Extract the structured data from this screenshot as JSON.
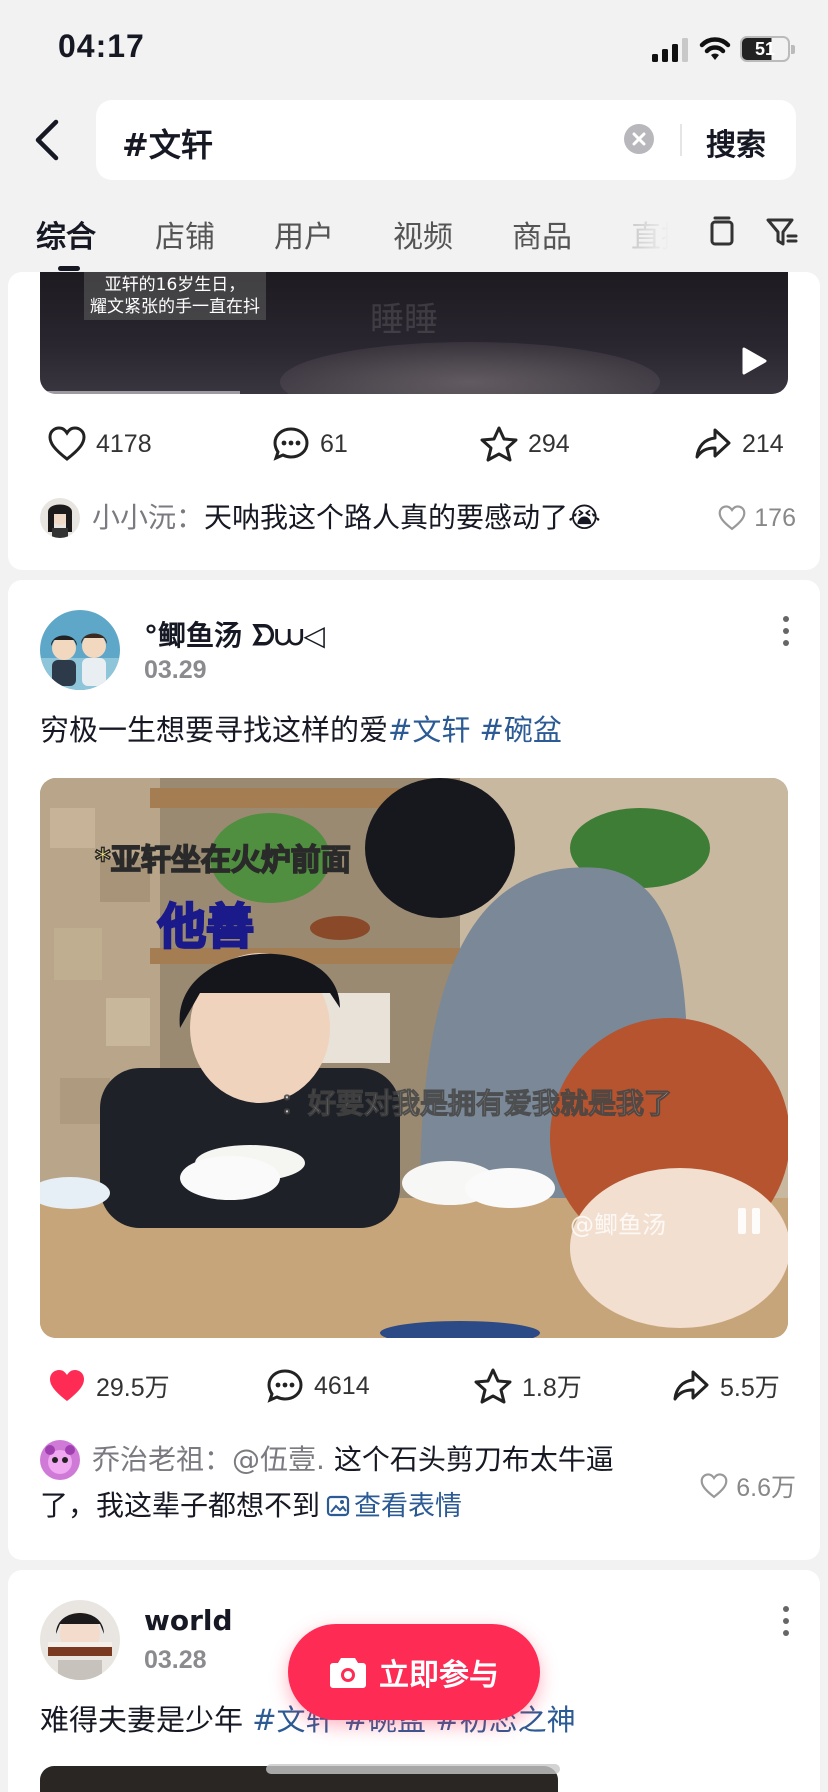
{
  "status": {
    "time": "04:17",
    "battery": "51"
  },
  "search": {
    "query": "#文轩",
    "button": "搜索"
  },
  "tabs": [
    "综合",
    "店铺",
    "用户",
    "视频",
    "商品",
    "直播"
  ],
  "post1": {
    "video_caption_line1": "亚轩的16岁生日，",
    "video_caption_line2": "耀文紧张的手一直在抖",
    "video_watermark": "睡睡",
    "likes": "4178",
    "comments": "61",
    "favorites": "294",
    "shares": "214",
    "comment": {
      "name": "小小沅：",
      "text": "天呐我这个路人真的要感动了😭",
      "likes": "176"
    }
  },
  "post2": {
    "author": "°鲫鱼汤 ᗤ⩊◁",
    "date": "03.29",
    "text": "穷极一生想要寻找这样的爱",
    "tags": [
      "#文轩",
      "#碗盆"
    ],
    "image_caption_top": "*亚轩坐在火炉前面",
    "image_caption_big": "他善",
    "image_subtitle": "：好要对我是拥有爱我就是我了",
    "image_watermark": "@鲫鱼汤",
    "likes": "29.5万",
    "comments": "4614",
    "favorites": "1.8万",
    "shares": "5.5万",
    "comment": {
      "name": "乔治老祖：",
      "mention": "@伍壹.",
      "text_line1": "这个石头剪刀布太牛逼",
      "text_line2": "了，我这辈子都想不到",
      "link": "查看表情",
      "likes": "6.6万"
    }
  },
  "post3": {
    "author": "world",
    "date": "03.28",
    "text": "难得夫妻是少年 ",
    "tags": [
      "#文轩",
      "#碗盆",
      "#初恋之神"
    ]
  },
  "cta": {
    "label": "立即参与"
  },
  "colors": {
    "accent": "#fe2c55",
    "tag": "#2b5a94",
    "liked": "#fe2c55"
  }
}
